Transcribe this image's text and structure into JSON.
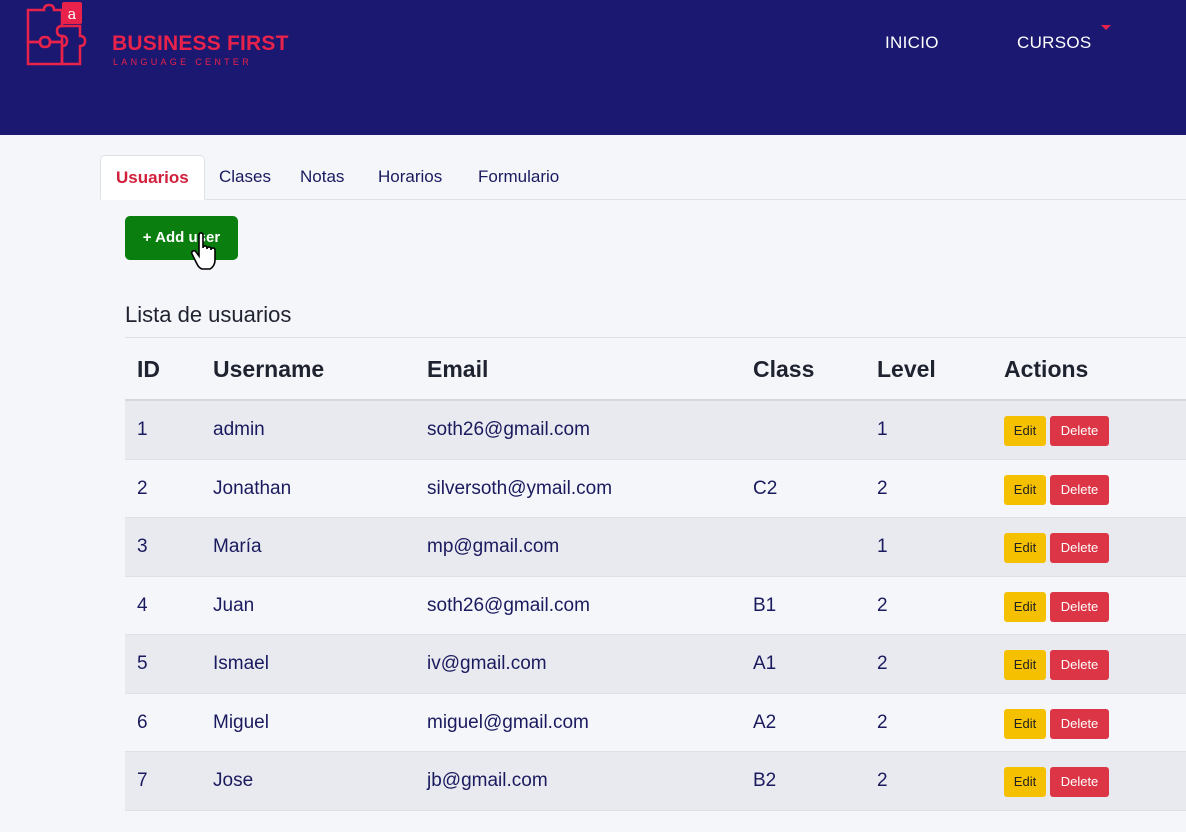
{
  "brand": {
    "name": "BUSINESS FIRST",
    "tagline": "LANGUAGE CENTER",
    "logo_icon": "puzzle-logo-icon",
    "color": "#e8224a"
  },
  "nav": {
    "items": [
      {
        "label": "INICIO"
      },
      {
        "label": "CURSOS",
        "has_dropdown": true
      }
    ]
  },
  "tabs": [
    {
      "label": "Usuarios",
      "active": true
    },
    {
      "label": "Clases"
    },
    {
      "label": "Notas"
    },
    {
      "label": "Horarios"
    },
    {
      "label": "Formulario"
    }
  ],
  "add_button": {
    "label": "+ Add user",
    "color": "#0a7f10"
  },
  "section_title": "Lista de usuarios",
  "table": {
    "headers": [
      "ID",
      "Username",
      "Email",
      "Class",
      "Level",
      "Actions"
    ],
    "edit_label": "Edit",
    "delete_label": "Delete",
    "rows": [
      {
        "id": "1",
        "username": "admin",
        "email": "soth26@gmail.com",
        "class": "",
        "level": "1"
      },
      {
        "id": "2",
        "username": "Jonathan",
        "email": "silversoth@ymail.com",
        "class": "C2",
        "level": "2"
      },
      {
        "id": "3",
        "username": "María",
        "email": "mp@gmail.com",
        "class": "",
        "level": "1"
      },
      {
        "id": "4",
        "username": "Juan",
        "email": "soth26@gmail.com",
        "class": "B1",
        "level": "2"
      },
      {
        "id": "5",
        "username": "Ismael",
        "email": "iv@gmail.com",
        "class": "A1",
        "level": "2"
      },
      {
        "id": "6",
        "username": "Miguel",
        "email": "miguel@gmail.com",
        "class": "A2",
        "level": "2"
      },
      {
        "id": "7",
        "username": "Jose",
        "email": "jb@gmail.com",
        "class": "B2",
        "level": "2"
      }
    ]
  },
  "colors": {
    "navbar": "#1a1870",
    "edit": "#f5c000",
    "delete": "#dc3545",
    "active_tab": "#d21f3c"
  }
}
